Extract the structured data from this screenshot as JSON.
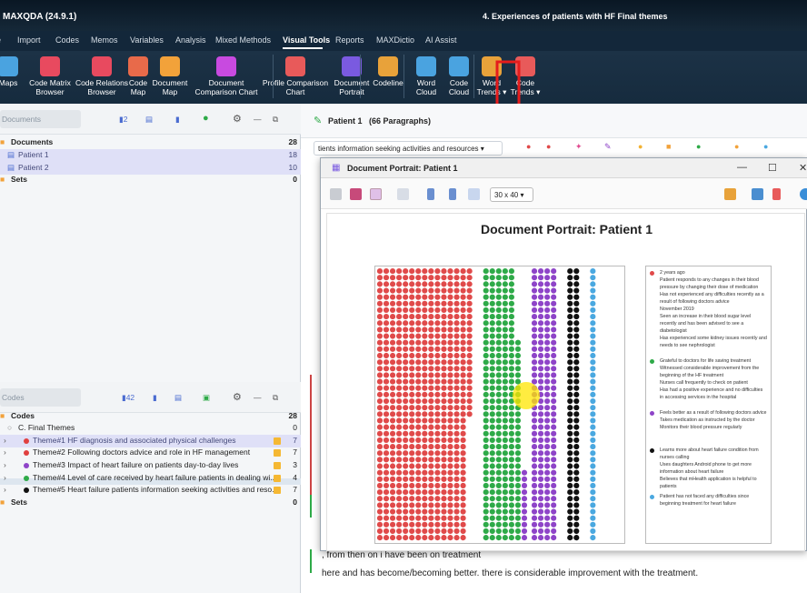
{
  "app": {
    "title": "MAXQDA (24.9.1)",
    "document_title": "4. Experiences of patients with HF Final themes"
  },
  "menu": {
    "items": [
      "e",
      "Import",
      "Codes",
      "Memos",
      "Variables",
      "Analysis",
      "Mixed Methods",
      "Visual Tools",
      "Reports",
      "MAXDictio",
      "AI Assist"
    ],
    "active": "Visual Tools"
  },
  "ribbon": {
    "buttons": [
      {
        "label": "Maps",
        "icon": "maps-icon",
        "color": "#4aa3e0"
      },
      {
        "label": "Code Matrix\nBrowser",
        "icon": "code-matrix-browser-icon",
        "color": "#e84a5f"
      },
      {
        "label": "Code Relations\nBrowser",
        "icon": "code-relations-browser-icon",
        "color": "#e84a5f"
      },
      {
        "label": "Code\nMap",
        "icon": "code-map-icon",
        "color": "#e86a4a"
      },
      {
        "label": "Document\nMap",
        "icon": "document-map-icon",
        "color": "#f2a23a"
      },
      {
        "label": "Document\nComparison Chart",
        "icon": "document-comparison-chart-icon",
        "color": "#c84ae0"
      },
      {
        "label": "Profile Comparison\nChart",
        "icon": "profile-comparison-chart-icon",
        "color": "#e85a5a"
      },
      {
        "label": "Document\nPortrait",
        "icon": "document-portrait-icon",
        "color": "#7a5ae0"
      },
      {
        "label": "Codeline",
        "icon": "codeline-icon",
        "color": "#e8a23a"
      },
      {
        "label": "Word\nCloud",
        "icon": "word-cloud-icon",
        "color": "#4aa3e0"
      },
      {
        "label": "Code\nCloud",
        "icon": "code-cloud-icon",
        "color": "#4aa3e0"
      },
      {
        "label": "Word\nTrends ▾",
        "icon": "word-trends-icon",
        "color": "#e8a23a"
      },
      {
        "label": "Code\nTrends ▾",
        "icon": "code-trends-icon",
        "color": "#e85a5a"
      }
    ]
  },
  "documents_pane": {
    "search_placeholder": "Documents",
    "count_badge": "2",
    "rows": [
      {
        "label": "Documents",
        "count": "28",
        "bold": true
      },
      {
        "label": "Patient 1",
        "count": "18",
        "selected": true
      },
      {
        "label": "Patient 2",
        "count": "10",
        "selected": true
      },
      {
        "label": "Sets",
        "count": "0",
        "bold": true
      }
    ]
  },
  "codes_pane": {
    "search_placeholder": "Codes",
    "count_badge": "42",
    "rows": [
      {
        "label": "Codes",
        "count": "28",
        "bold": true
      },
      {
        "label": "C. Final Themes",
        "count": "0"
      },
      {
        "label": "Theme#1 HF diagnosis and associated physical challenges",
        "count": "7",
        "color": "#e04040",
        "selected": true
      },
      {
        "label": "Theme#2 Following doctors advice and role in HF management",
        "count": "7",
        "color": "#e04040"
      },
      {
        "label": "Theme#3 Impact of heart failure on patients day-to-day lives",
        "count": "3",
        "color": "#8e44c8"
      },
      {
        "label": "Theme#4 Level of care received  by heart failure patients in  dealing wi...",
        "count": "4",
        "color": "#2eaa48"
      },
      {
        "label": "Theme#5 Heart failure patients information seeking activities and reso...",
        "count": "7",
        "color": "#111111"
      },
      {
        "label": "Sets",
        "count": "0",
        "bold": true
      }
    ]
  },
  "document_browser": {
    "title": "Patient 1",
    "paragraphs": "(66 Paragraphs)",
    "paragraph_select": "tients information seeking activities and resources",
    "text_lines": [
      ", from then on i have been on treatment",
      "here and has become/becoming better. there is considerable improvement with the treatment."
    ]
  },
  "portrait_window": {
    "title": "Document Portrait: Patient 1",
    "zoom": "30 x 40",
    "chart_title": "Document Portrait: Patient 1",
    "colors": {
      "red": "#e04a4a",
      "green": "#2eaa48",
      "purple": "#8e44c8",
      "black": "#111111",
      "blue": "#4aa8e0"
    },
    "legend": [
      {
        "color": "#e04a4a",
        "text": "2 years ago\nPatient responds to any changes in their blood pressure by changing their dose of medication\nHas not experienced any difficulties recently as a result of following doctors advice\nNovember 2019\nSeen an increase in their blood sugar level recently and has been advised to see a diabetologist\nHas experienced some kidney issues recently and needs to see nephrologist"
      },
      {
        "color": "#2eaa48",
        "text": "Grateful to doctors for life saving treatment\nWitnessed considerable improvement from the beginning of the HF treatment\nNurses call frequently to check on patient\nHas had a positive experience and no difficulties in accessing services in the hospital"
      },
      {
        "color": "#8e44c8",
        "text": "Feels better as a result of following doctors advice\nTakes medication as instructed by the doctor\nMonitors their blood pressure regularly"
      },
      {
        "color": "#111111",
        "text": "Learns more about heart failure condition from nurses calling\nUses daughters Android phone to get more information about heart failure\nBelieves that mHealth application is helpful to patients"
      },
      {
        "color": "#4aa8e0",
        "text": "Patient has not faced any difficulties since beginning treatment for heart failure"
      }
    ]
  }
}
